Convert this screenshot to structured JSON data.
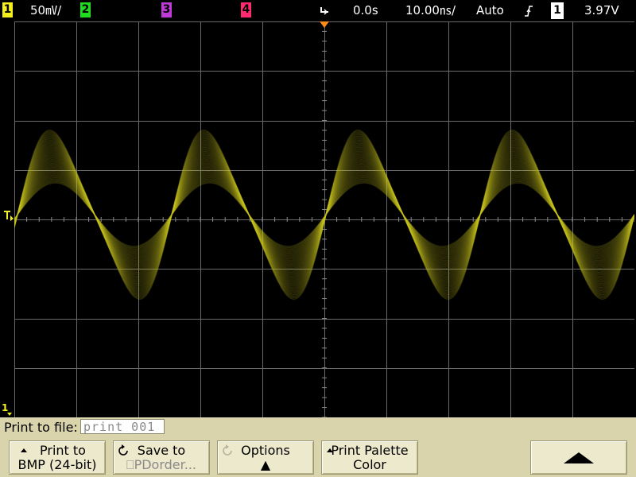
{
  "top_bar": {
    "ch1_label": "1",
    "ch1_scale": "50㎷/",
    "ch2_label": "2",
    "ch3_label": "3",
    "ch4_label": "4",
    "time_delay": "0.0s",
    "time_scale": "10.00㎱/",
    "trigger_mode": "Auto",
    "trigger_slope_icon": "rising-edge-icon",
    "trigger_source": "1",
    "trigger_level": "3.97V",
    "colors": {
      "ch1": "#f2ef1c",
      "ch2": "#1fdc1f",
      "ch3": "#c03ad8",
      "ch4": "#ff2b6e",
      "trigger_marker": "#ff8a1a"
    }
  },
  "graticule": {
    "trigger_level_marker": "T",
    "ground_marker": "1",
    "trace_color": "#c8c41e"
  },
  "print_panel": {
    "label": "Print to file:",
    "filename": "print_001"
  },
  "softkeys": [
    {
      "line1": "Print to",
      "line2": "BMP (24-bit)"
    },
    {
      "line1": "Save to",
      "line2": "⎕PDorder..."
    },
    {
      "line1": "Options",
      "line2": "▲"
    },
    {
      "line1": "Print Palette",
      "line2": "Color"
    },
    {
      "line1": "",
      "line2": ""
    }
  ]
}
